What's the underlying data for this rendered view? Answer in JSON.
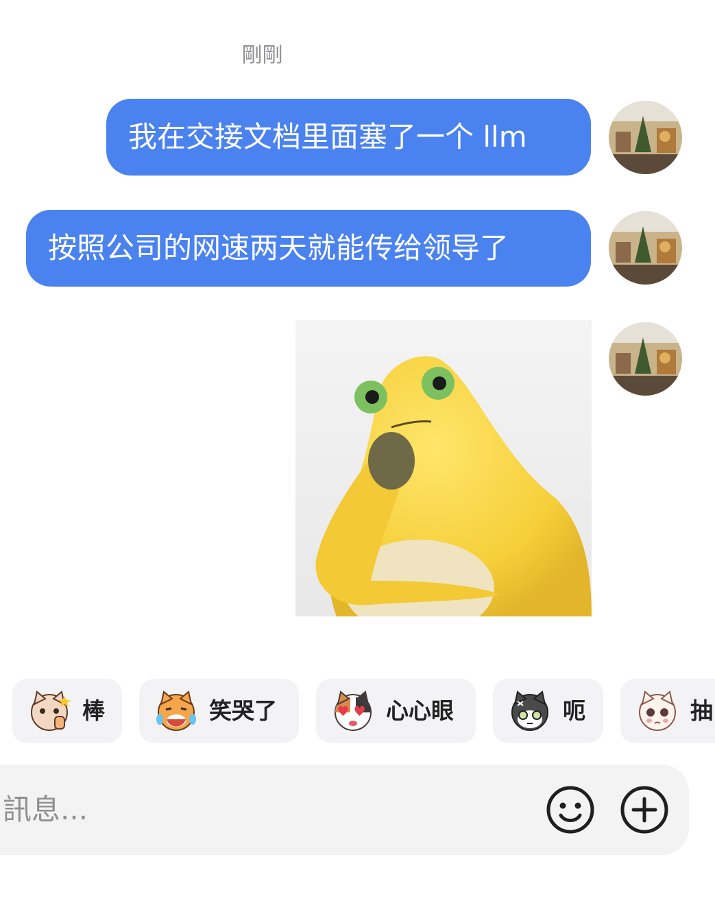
{
  "timestamp": "剛剛",
  "messages": [
    {
      "type": "text",
      "text": "我在交接文档里面塞了一个 llm"
    },
    {
      "type": "text",
      "text": "按照公司的网速两天就能传给领导了"
    },
    {
      "type": "sticker",
      "sticker": "yellow-blob-thinking"
    }
  ],
  "colors": {
    "bubble": "#4a82f0",
    "chip_bg": "#f3f3f5",
    "input_bg": "#f3f3f3"
  },
  "reactions": [
    {
      "label": "棒",
      "icon": "cat-thumbs-up-icon"
    },
    {
      "label": "笑哭了",
      "icon": "cat-laugh-cry-icon"
    },
    {
      "label": "心心眼",
      "icon": "cat-heart-eyes-icon"
    },
    {
      "label": "呃",
      "icon": "cat-speechless-icon"
    },
    {
      "label": "抽",
      "icon": "cat-sob-icon"
    }
  ],
  "input": {
    "placeholder": "訊息...",
    "emoji_icon": "smiley-icon",
    "add_icon": "plus-circle-icon"
  }
}
